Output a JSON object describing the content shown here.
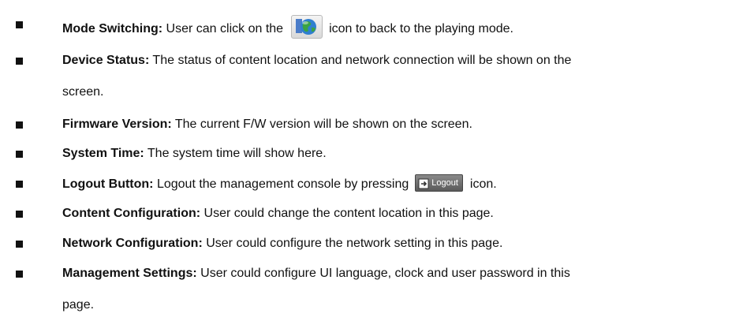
{
  "items": [
    {
      "term": "Mode Switching:",
      "text_before_icon": " User can click on the",
      "icon": "globe-icon",
      "text_after_icon": "icon to back to the playing mode."
    },
    {
      "term": "Device Status:",
      "text": " The status of content location and network connection will be shown on the",
      "continuation": "screen."
    },
    {
      "term": "Firmware Version:",
      "text": " The current F/W version will be shown on the screen."
    },
    {
      "term": "System Time:",
      "text": " The system time will show here."
    },
    {
      "term": "Logout Button:",
      "text_before_icon": " Logout the management console by pressing",
      "icon": "logout-icon",
      "icon_label": "Logout",
      "text_after_icon": "icon."
    },
    {
      "term": "Content Configuration:",
      "text": " User could change the content location in this page."
    },
    {
      "term": "Network Configuration:",
      "text": " User could configure the network setting in this page."
    },
    {
      "term": "Management Settings:",
      "text": " User could configure UI language, clock and user password in this",
      "continuation": "page."
    }
  ]
}
